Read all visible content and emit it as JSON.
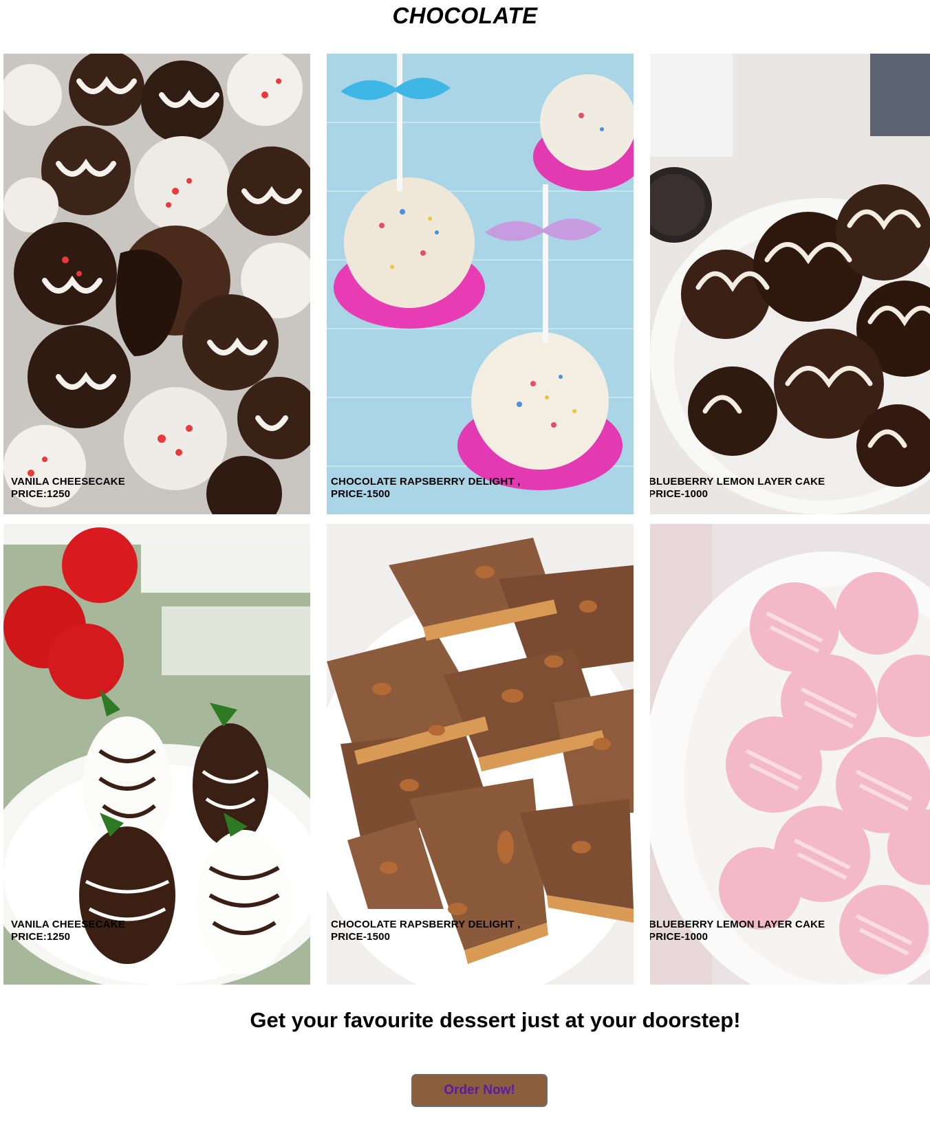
{
  "page": {
    "title": "CHOCOLATE",
    "tagline": "Get your favourite dessert just at your doorstep!",
    "order_button": "Order Now!"
  },
  "products": [
    {
      "name": "VANILA CHEESECAKE",
      "price": "PRICE:1250",
      "image": "chocolate truffles with peppermint drizzle"
    },
    {
      "name": "CHOCOLATE RAPSBERRY DELIGHT ,",
      "price": "PRICE-1500",
      "image": "popcorn balls on sticks with ribbons"
    },
    {
      "name": "BLUEBERRY LEMON LAYER CAKE",
      "price": "PRICE-1000",
      "image": "oreo balls with white drizzle in bowl"
    },
    {
      "name": "VANILA CHEESECAKE",
      "price": "PRICE:1250",
      "image": "chocolate covered strawberries"
    },
    {
      "name": "CHOCOLATE RAPSBERRY DELIGHT ,",
      "price": "PRICE-1500",
      "image": "chocolate toffee bark with pecans"
    },
    {
      "name": "BLUEBERRY LEMON LAYER CAKE",
      "price": "PRICE-1000",
      "image": "pink cream cheese mints in bowl"
    }
  ],
  "colors": {
    "button_bg": "#8b5e3c",
    "button_text": "#5a1aa8"
  }
}
